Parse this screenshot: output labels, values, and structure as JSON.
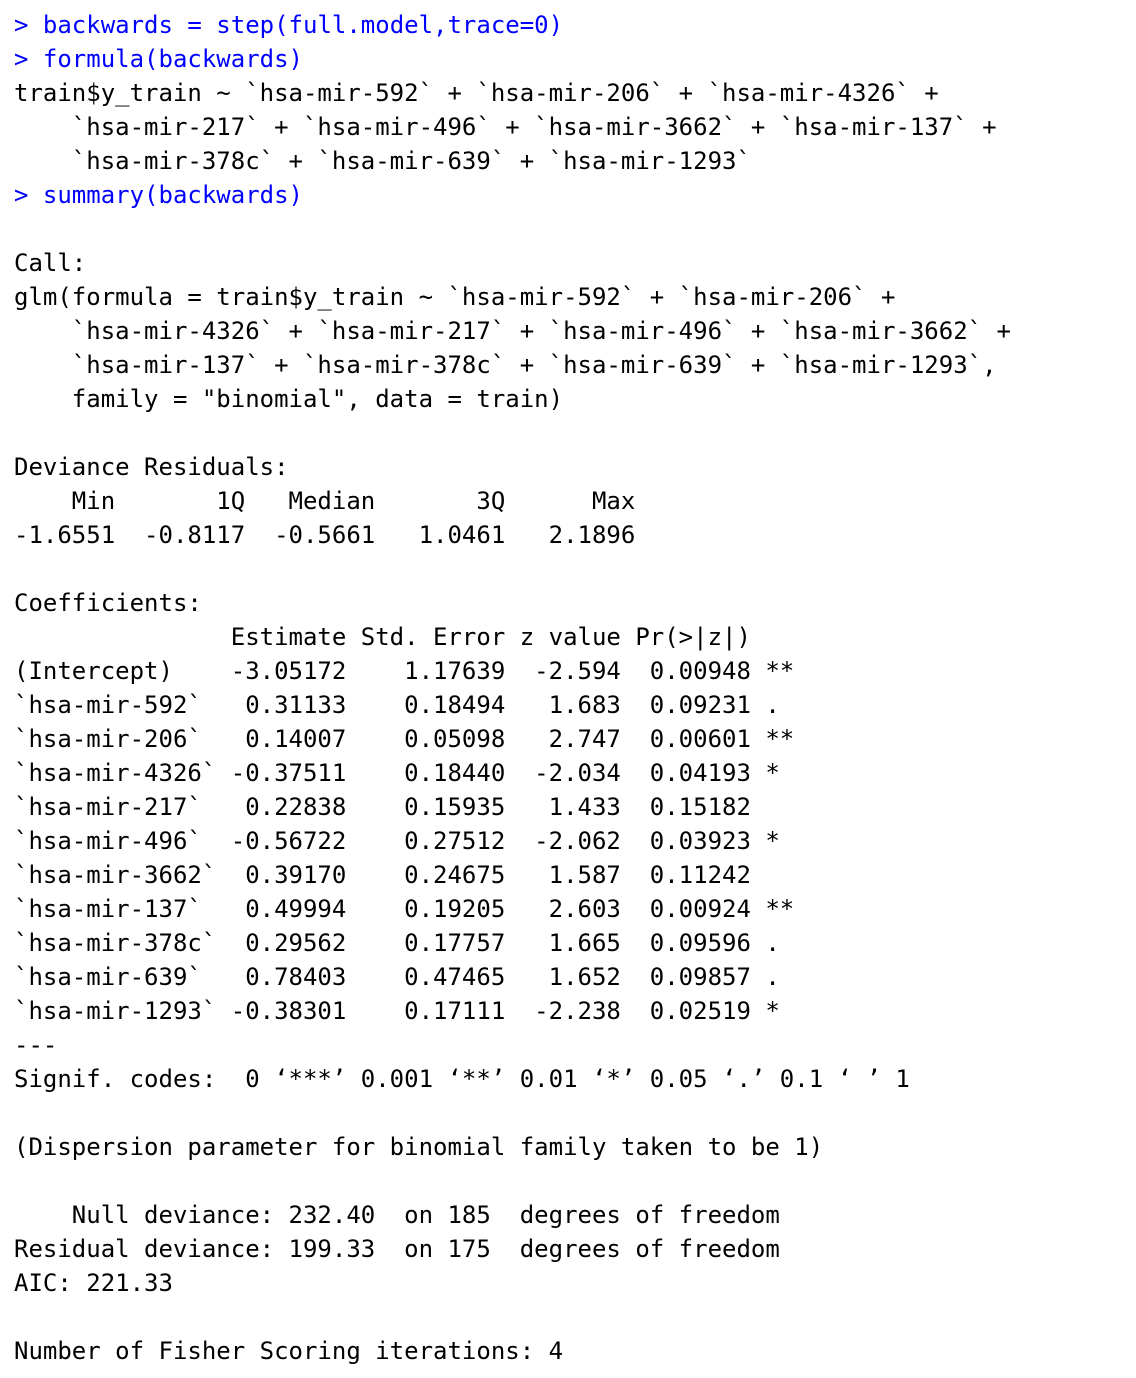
{
  "colors": {
    "command": "#0000ff",
    "output": "#000000",
    "background": "#ffffff"
  },
  "console": {
    "prompt": "> ",
    "lines": [
      {
        "type": "cmd",
        "text": "backwards = step(full.model,trace=0)"
      },
      {
        "type": "cmd",
        "text": "formula(backwards)"
      },
      {
        "type": "out",
        "text": "train$y_train ~ `hsa-mir-592` + `hsa-mir-206` + `hsa-mir-4326` +"
      },
      {
        "type": "out",
        "text": "    `hsa-mir-217` + `hsa-mir-496` + `hsa-mir-3662` + `hsa-mir-137` +"
      },
      {
        "type": "out",
        "text": "    `hsa-mir-378c` + `hsa-mir-639` + `hsa-mir-1293`"
      },
      {
        "type": "cmd",
        "text": "summary(backwards)"
      },
      {
        "type": "blank",
        "text": ""
      },
      {
        "type": "out",
        "text": "Call:"
      },
      {
        "type": "out",
        "text": "glm(formula = train$y_train ~ `hsa-mir-592` + `hsa-mir-206` +"
      },
      {
        "type": "out",
        "text": "    `hsa-mir-4326` + `hsa-mir-217` + `hsa-mir-496` + `hsa-mir-3662` +"
      },
      {
        "type": "out",
        "text": "    `hsa-mir-137` + `hsa-mir-378c` + `hsa-mir-639` + `hsa-mir-1293`,"
      },
      {
        "type": "out",
        "text": "    family = \"binomial\", data = train)"
      },
      {
        "type": "blank",
        "text": ""
      },
      {
        "type": "out",
        "text": "Deviance Residuals:"
      },
      {
        "type": "out",
        "text": "    Min       1Q   Median       3Q      Max"
      },
      {
        "type": "out",
        "text": "-1.6551  -0.8117  -0.5661   1.0461   2.1896"
      },
      {
        "type": "blank",
        "text": ""
      },
      {
        "type": "out",
        "text": "Coefficients:"
      },
      {
        "type": "out",
        "text": "               Estimate Std. Error z value Pr(>|z|)"
      },
      {
        "type": "out",
        "text": "(Intercept)    -3.05172    1.17639  -2.594  0.00948 **"
      },
      {
        "type": "out",
        "text": "`hsa-mir-592`   0.31133    0.18494   1.683  0.09231 ."
      },
      {
        "type": "out",
        "text": "`hsa-mir-206`   0.14007    0.05098   2.747  0.00601 **"
      },
      {
        "type": "out",
        "text": "`hsa-mir-4326` -0.37511    0.18440  -2.034  0.04193 *"
      },
      {
        "type": "out",
        "text": "`hsa-mir-217`   0.22838    0.15935   1.433  0.15182"
      },
      {
        "type": "out",
        "text": "`hsa-mir-496`  -0.56722    0.27512  -2.062  0.03923 *"
      },
      {
        "type": "out",
        "text": "`hsa-mir-3662`  0.39170    0.24675   1.587  0.11242"
      },
      {
        "type": "out",
        "text": "`hsa-mir-137`   0.49994    0.19205   2.603  0.00924 **"
      },
      {
        "type": "out",
        "text": "`hsa-mir-378c`  0.29562    0.17757   1.665  0.09596 ."
      },
      {
        "type": "out",
        "text": "`hsa-mir-639`   0.78403    0.47465   1.652  0.09857 ."
      },
      {
        "type": "out",
        "text": "`hsa-mir-1293` -0.38301    0.17111  -2.238  0.02519 *"
      },
      {
        "type": "out",
        "text": "---"
      },
      {
        "type": "out",
        "text": "Signif. codes:  0 ‘***’ 0.001 ‘**’ 0.01 ‘*’ 0.05 ‘.’ 0.1 ‘ ’ 1"
      },
      {
        "type": "blank",
        "text": ""
      },
      {
        "type": "out",
        "text": "(Dispersion parameter for binomial family taken to be 1)"
      },
      {
        "type": "blank",
        "text": ""
      },
      {
        "type": "out",
        "text": "    Null deviance: 232.40  on 185  degrees of freedom"
      },
      {
        "type": "out",
        "text": "Residual deviance: 199.33  on 175  degrees of freedom"
      },
      {
        "type": "out",
        "text": "AIC: 221.33"
      },
      {
        "type": "blank",
        "text": ""
      },
      {
        "type": "out",
        "text": "Number of Fisher Scoring iterations: 4"
      }
    ]
  }
}
